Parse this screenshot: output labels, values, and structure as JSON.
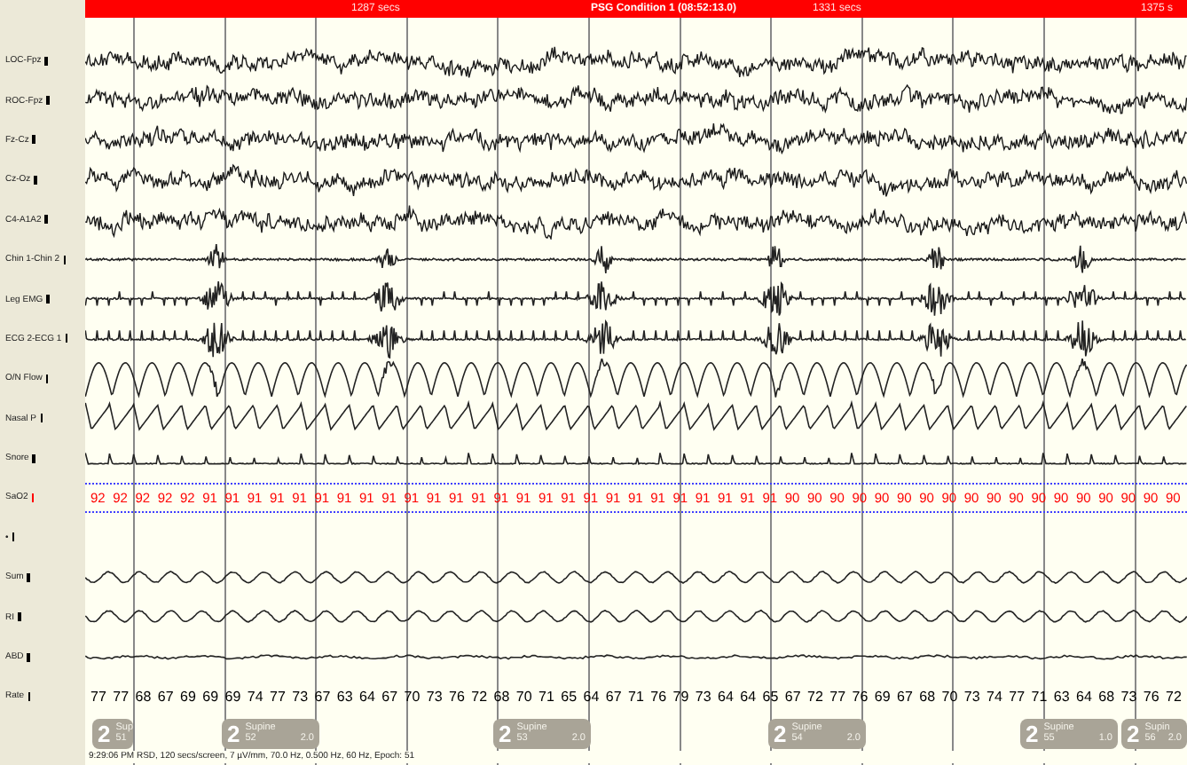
{
  "header": {
    "left_time": "1287 secs",
    "title": "PSG Condition 1 (08:52:13.0)",
    "mid_time": "1331 secs",
    "right_time": "1375 s"
  },
  "channels": [
    {
      "name": "LOC-Fpz",
      "kind": "eeg",
      "color": "#000000"
    },
    {
      "name": "ROC-Fpz",
      "kind": "eeg",
      "color": "#000000"
    },
    {
      "name": "Fz-Cz",
      "kind": "eeg",
      "color": "#000000"
    },
    {
      "name": "Cz-Oz",
      "kind": "eeg",
      "color": "#000000"
    },
    {
      "name": "C4-A1A2",
      "kind": "eeg",
      "color": "#000000"
    },
    {
      "name": "Chin 1-Chin 2",
      "kind": "chin",
      "color": "#000000"
    },
    {
      "name": "Leg EMG",
      "kind": "leg",
      "color": "#000000"
    },
    {
      "name": "ECG 2-ECG 1",
      "kind": "ecg",
      "color": "#000000"
    },
    {
      "name": "O/N Flow",
      "kind": "flow",
      "color": "#000000"
    },
    {
      "name": "Nasal P",
      "kind": "nasal",
      "color": "#000000"
    },
    {
      "name": "Snore",
      "kind": "snore",
      "color": "#000000"
    },
    {
      "name": "SaO2",
      "kind": "sao2",
      "color": "#ff0000",
      "values": [
        "92",
        "92",
        "92",
        "92",
        "92",
        "91",
        "91",
        "91",
        "91",
        "91",
        "91",
        "91",
        "91",
        "91",
        "91",
        "91",
        "91",
        "91",
        "91",
        "91",
        "91",
        "91",
        "91",
        "91",
        "91",
        "91",
        "91",
        "91",
        "91",
        "91",
        "91",
        "90",
        "90",
        "90",
        "90",
        "90",
        "90",
        "90",
        "90",
        "90",
        "90",
        "90",
        "90",
        "90",
        "90",
        "90",
        "90",
        "90",
        "90"
      ]
    },
    {
      "name": "•",
      "kind": "blank",
      "color": "#000000"
    },
    {
      "name": "Sum",
      "kind": "effort",
      "color": "#000000"
    },
    {
      "name": "RI",
      "kind": "effort",
      "color": "#000000"
    },
    {
      "name": "ABD",
      "kind": "abd",
      "color": "#000000"
    },
    {
      "name": "Rate",
      "kind": "rate",
      "color": "#000000",
      "values": [
        "77",
        "77",
        "68",
        "67",
        "69",
        "69",
        "69",
        "74",
        "77",
        "73",
        "67",
        "63",
        "64",
        "67",
        "70",
        "73",
        "76",
        "72",
        "68",
        "70",
        "71",
        "65",
        "64",
        "67",
        "71",
        "76",
        "79",
        "73",
        "64",
        "64",
        "65",
        "67",
        "72",
        "77",
        "76",
        "69",
        "67",
        "68",
        "70",
        "73",
        "74",
        "77",
        "71",
        "63",
        "64",
        "68",
        "73",
        "76",
        "72"
      ]
    }
  ],
  "stages": [
    {
      "stage": "2",
      "position": "Sup",
      "epoch": "51"
    },
    {
      "stage": "2",
      "position": "Supine",
      "epoch": "52",
      "value": "2.0"
    },
    {
      "stage": "2",
      "position": "Supine",
      "epoch": "53",
      "value": "2.0"
    },
    {
      "stage": "2",
      "position": "Supine",
      "epoch": "54",
      "value": "2.0"
    },
    {
      "stage": "2",
      "position": "Supine",
      "epoch": "55",
      "value": "1.0"
    },
    {
      "stage": "2",
      "position": "Supin",
      "epoch": "56",
      "value": "2.0"
    }
  ],
  "status": "9:29:06 PM RSD, 120 secs/screen, 7 µV/mm, 70.0 Hz, 0.500 Hz, 60 Hz, Epoch: 51"
}
